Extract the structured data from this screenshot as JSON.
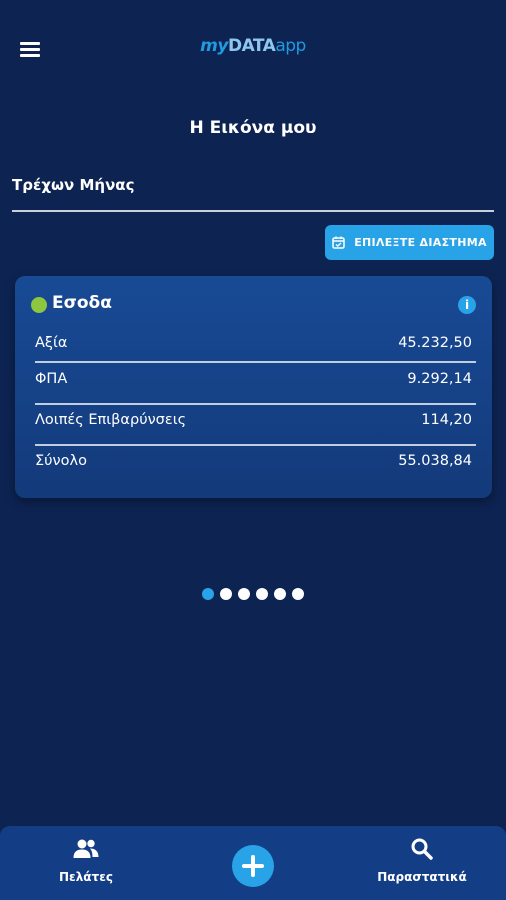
{
  "app": {
    "logo_my": "my",
    "logo_data": "DATA",
    "logo_app": "app"
  },
  "header": {
    "menu_icon": "menu-icon"
  },
  "page": {
    "title": "Η Εικόνα μου"
  },
  "period": {
    "label": "Τρέχων Μήνας"
  },
  "range_button": {
    "label": "ΕΠΙΛΕΞΤΕ ΔΙΑΣΤΗΜΑ",
    "icon": "calendar-icon"
  },
  "card": {
    "title": "Εσοδα",
    "status_color": "#8dc63f",
    "info_icon": "i",
    "rows": [
      {
        "label": "Αξία",
        "value": "45.232,50"
      },
      {
        "label": "ΦΠΑ",
        "value": "9.292,14"
      },
      {
        "label": "Λοιπές Επιβαρύνσεις",
        "value": "114,20"
      },
      {
        "label": "Σύνολο",
        "value": "55.038,84"
      }
    ]
  },
  "pager": {
    "count": 6,
    "active": 0
  },
  "bottom_nav": {
    "clients_label": "Πελάτες",
    "documents_label": "Παραστατικά"
  },
  "colors": {
    "background": "#0d2352",
    "accent": "#29a3e8",
    "card": "#184a95"
  }
}
